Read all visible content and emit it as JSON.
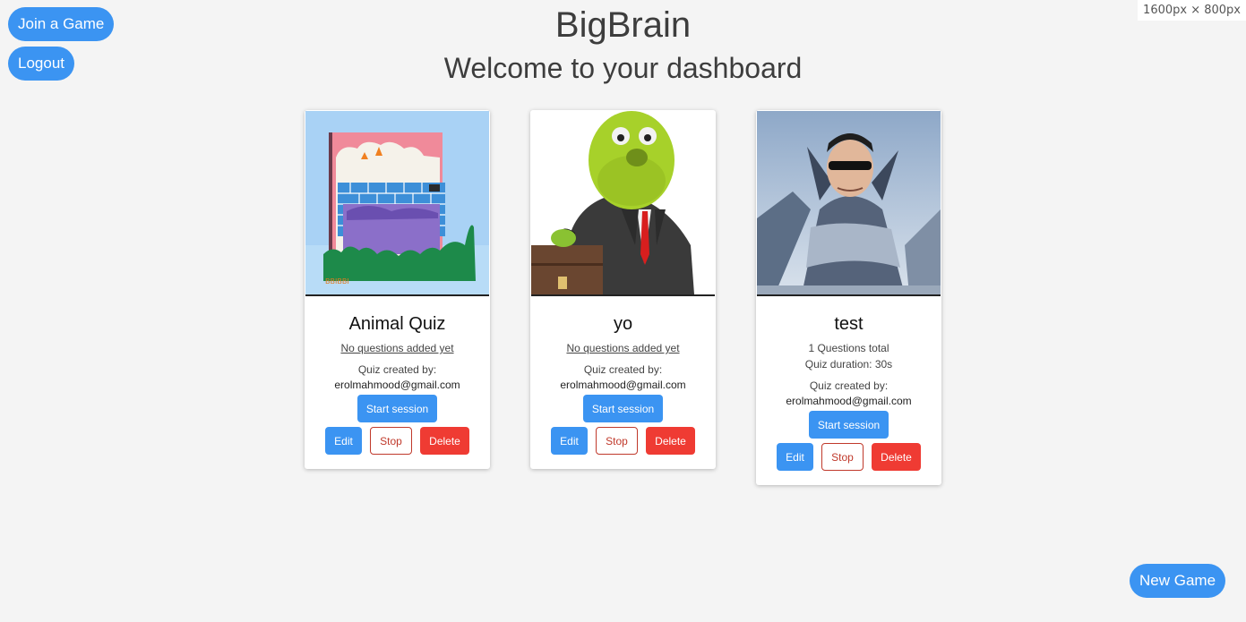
{
  "nav": {
    "join_label": "Join a Game",
    "logout_label": "Logout",
    "new_game_label": "New Game"
  },
  "viewport_badge": "1600px × 800px",
  "header": {
    "title": "BigBrain",
    "subtitle": "Welcome to your dashboard"
  },
  "colors": {
    "primary": "#3b94f2",
    "danger": "#ef3b33",
    "stop_outline": "#c0392b",
    "background": "#f4f4f4"
  },
  "cards": [
    {
      "title": "Animal Quiz",
      "info_line1": "No questions added yet",
      "info_line2": "",
      "creator_label": "Quiz created by:",
      "creator_email": "erolmahmood@gmail.com",
      "start_label": "Start session",
      "edit_label": "Edit",
      "stop_label": "Stop",
      "delete_label": "Delete",
      "thumbnail_watermark": "BBIBBI"
    },
    {
      "title": "yo",
      "info_line1": "No questions added yet",
      "info_line2": "",
      "creator_label": "Quiz created by:",
      "creator_email": "erolmahmood@gmail.com",
      "start_label": "Start session",
      "edit_label": "Edit",
      "stop_label": "Stop",
      "delete_label": "Delete"
    },
    {
      "title": "test",
      "info_line1": "1 Questions total",
      "info_line2": "Quiz duration: 30s",
      "creator_label": "Quiz created by:",
      "creator_email": "erolmahmood@gmail.com",
      "start_label": "Start session",
      "edit_label": "Edit",
      "stop_label": "Stop",
      "delete_label": "Delete"
    }
  ]
}
